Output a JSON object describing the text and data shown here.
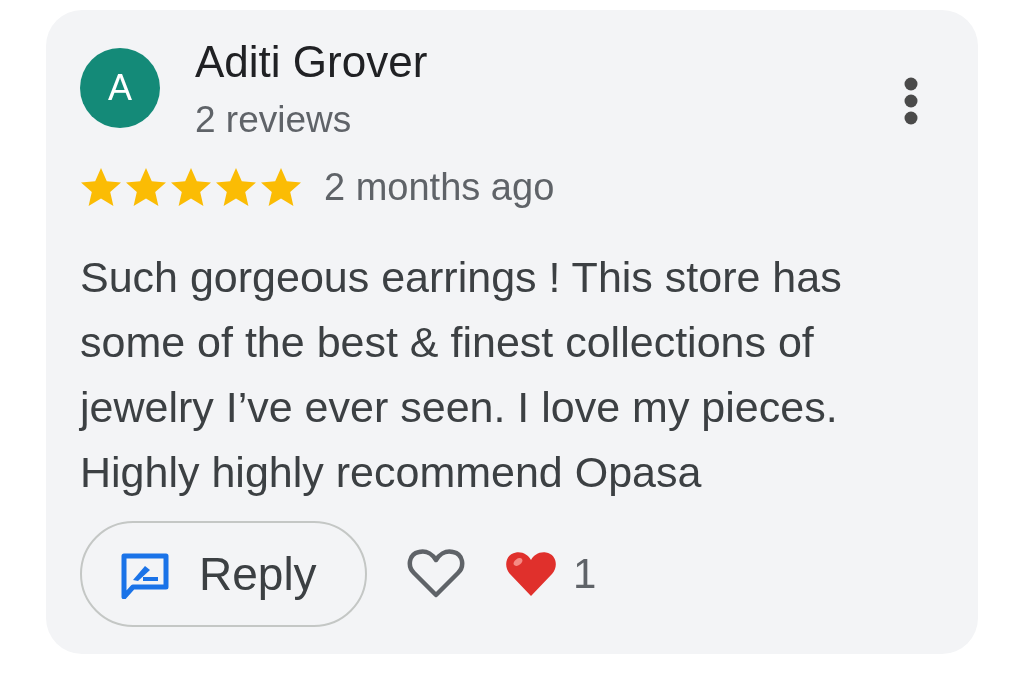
{
  "review": {
    "avatar_initial": "A",
    "author": "Aditi Grover",
    "review_count": "2 reviews",
    "stars": 5,
    "time": "2 months ago",
    "text": "Such gorgeous earrings ! This store has some of the best & finest collections of jewelry I’ve ever seen. I love my pieces. Highly highly recommend Opasa",
    "reply_button": "Reply",
    "liked": false,
    "heart_reaction_count": "1"
  }
}
